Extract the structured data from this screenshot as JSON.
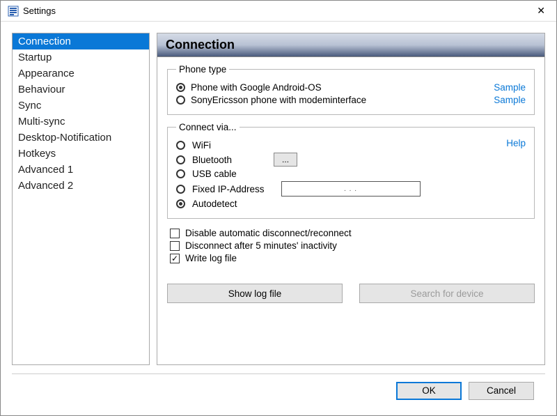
{
  "window": {
    "title": "Settings"
  },
  "sidebar": {
    "items": [
      {
        "label": "Connection",
        "selected": true
      },
      {
        "label": "Startup"
      },
      {
        "label": "Appearance"
      },
      {
        "label": "Behaviour"
      },
      {
        "label": "Sync"
      },
      {
        "label": "Multi-sync"
      },
      {
        "label": "Desktop-Notification"
      },
      {
        "label": "Hotkeys"
      },
      {
        "label": "Advanced 1"
      },
      {
        "label": "Advanced 2"
      }
    ]
  },
  "content": {
    "header": "Connection",
    "phone_type": {
      "legend": "Phone type",
      "options": [
        {
          "label": "Phone with Google Android-OS",
          "checked": true,
          "link": "Sample"
        },
        {
          "label": "SonyEricsson phone with modeminterface",
          "checked": false,
          "link": "Sample"
        }
      ]
    },
    "connect_via": {
      "legend": "Connect via...",
      "help": "Help",
      "options": [
        {
          "label": "WiFi",
          "checked": false
        },
        {
          "label": "Bluetooth",
          "checked": false,
          "has_button": true,
          "button_label": "..."
        },
        {
          "label": "USB cable",
          "checked": false
        },
        {
          "label": "Fixed IP-Address",
          "checked": false,
          "has_ip_input": true,
          "ip_value": ".       .       ."
        },
        {
          "label": "Autodetect",
          "checked": true
        }
      ]
    },
    "checks": [
      {
        "label": "Disable automatic disconnect/reconnect",
        "checked": false
      },
      {
        "label": "Disconnect after 5 minutes' inactivity",
        "checked": false
      },
      {
        "label": "Write log file",
        "checked": true
      }
    ],
    "buttons": {
      "show_log": "Show log file",
      "search_device": "Search for device"
    }
  },
  "dialog": {
    "ok": "OK",
    "cancel": "Cancel"
  }
}
